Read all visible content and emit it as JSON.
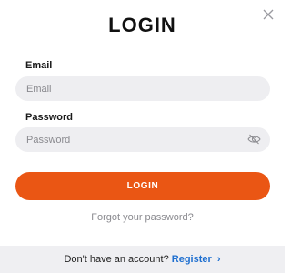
{
  "modal": {
    "title": "LOGIN",
    "close_icon": "close-icon"
  },
  "form": {
    "email": {
      "label": "Email",
      "placeholder": "Email",
      "value": ""
    },
    "password": {
      "label": "Password",
      "placeholder": "Password",
      "value": "",
      "toggle_icon": "eye-icon"
    },
    "submit_label": "LOGIN",
    "forgot_label": "Forgot your password?"
  },
  "footer": {
    "prompt": "Don't have an account?",
    "register_label": "Register",
    "register_icon": "chevron-right-icon"
  },
  "colors": {
    "accent": "#ea5614",
    "link": "#1e6fd0",
    "field_bg": "#eeeef1",
    "footer_bg": "#efeff2"
  }
}
